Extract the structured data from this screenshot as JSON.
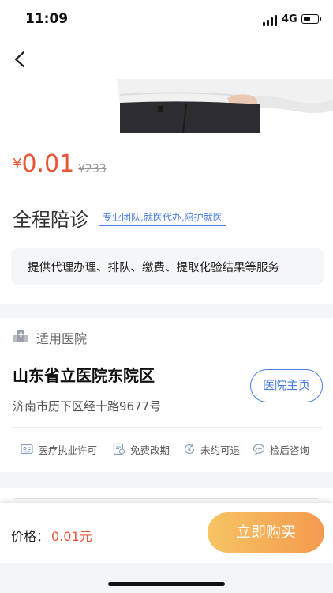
{
  "status_bar": {
    "time": "11:09",
    "network": "4G"
  },
  "product": {
    "currency": "¥",
    "price": "0.01",
    "original_price": "¥233",
    "title": "全程陪诊",
    "tag": "专业团队,就医代办,陪护就医",
    "description": "提供代理办理、排队、缴费、提取化验结果等服务"
  },
  "hospital": {
    "section_label": "适用医院",
    "name": "山东省立医院东院区",
    "address": "济南市历下区经十路9677号",
    "homepage_label": "医院主页"
  },
  "features": [
    {
      "label": "医疗执业许可",
      "icon": "license-icon"
    },
    {
      "label": "免费改期",
      "icon": "reschedule-icon"
    },
    {
      "label": "未约可退",
      "icon": "refund-icon"
    },
    {
      "label": "检后咨询",
      "icon": "chat-icon"
    }
  ],
  "bottom_bar": {
    "price_label": "价格：",
    "price_value": "0.01元",
    "buy_label": "立即购买"
  },
  "colors": {
    "price": "#e8563a",
    "accent": "#4a7de0",
    "buy_from": "#f7c463",
    "buy_to": "#f39a4f"
  }
}
